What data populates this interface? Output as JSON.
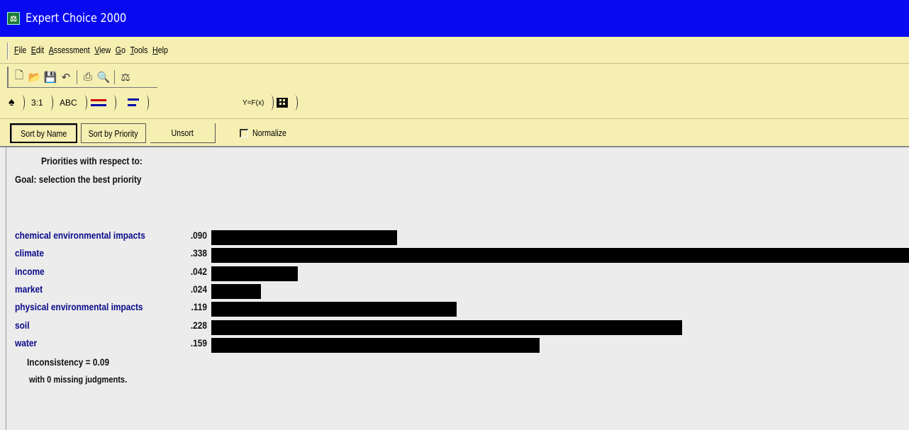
{
  "window": {
    "title": "Expert Choice 2000",
    "icon": "ec-app-icon"
  },
  "menu": [
    {
      "label": "File",
      "key": "F",
      "rest": "ile"
    },
    {
      "label": "Edit",
      "key": "E",
      "rest": "dit"
    },
    {
      "label": "Assessment",
      "key": "A",
      "rest": "ssessment"
    },
    {
      "label": "View",
      "key": "V",
      "rest": "iew"
    },
    {
      "label": "Go",
      "key": "G",
      "rest": "o"
    },
    {
      "label": "Tools",
      "key": "T",
      "rest": "ools"
    },
    {
      "label": "Help",
      "key": "H",
      "rest": "elp"
    }
  ],
  "toolbar": {
    "icons": [
      "new-document-icon",
      "open-folder-icon",
      "save-icon",
      "undo-icon",
      "print-icon",
      "print-preview-icon",
      "scales-icon"
    ]
  },
  "mode_tabs": {
    "t1": "3:1",
    "t2": "ABC",
    "t3": "Y=F(x)"
  },
  "buttons": {
    "sort_by_name": "Sort by Name",
    "sort_by_priority": "Sort by Priority",
    "unsort": "Unsort",
    "normalize": "Normalize"
  },
  "content": {
    "heading1": "Priorities with respect to:",
    "heading2": "Goal: selection the best priority",
    "inconsistency": "Inconsistency = 0.09",
    "missing": "with 0  missing judgments."
  },
  "chart_data": {
    "type": "bar",
    "categories": [
      "chemical environmental impacts",
      "climate",
      "income",
      "market",
      "physical environmental impacts",
      "soil",
      "water"
    ],
    "values": [
      0.09,
      0.338,
      0.042,
      0.024,
      0.119,
      0.228,
      0.159
    ],
    "labels": [
      ".090",
      ".338",
      ".042",
      ".024",
      ".119",
      ".228",
      ".159"
    ],
    "bar_color": "#000000",
    "label_color": "#0a0a8a"
  }
}
